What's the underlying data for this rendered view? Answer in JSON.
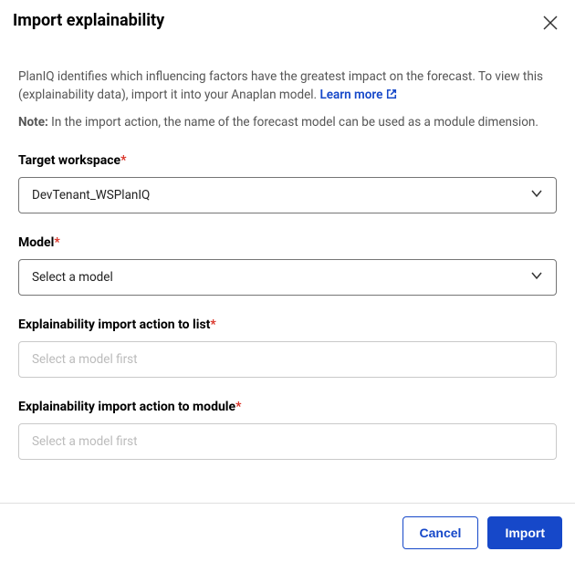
{
  "dialog": {
    "title": "Import explainability",
    "description_part1": "PlanIQ identifies which influencing factors have the greatest impact on the forecast. To view this (explainability data), import it into your Anaplan model. ",
    "learn_more": "Learn more",
    "note_label": "Note:",
    "note_text": " In the import action, the name of the forecast model can be used as a module dimension.",
    "fields": {
      "target_workspace": {
        "label": "Target workspace",
        "value": "DevTenant_WSPlanIQ"
      },
      "model": {
        "label": "Model",
        "placeholder": "Select a model"
      },
      "import_to_list": {
        "label": "Explainability import action to list",
        "placeholder": "Select a model first"
      },
      "import_to_module": {
        "label": "Explainability import action to module",
        "placeholder": "Select a model first"
      }
    },
    "buttons": {
      "cancel": "Cancel",
      "import": "Import"
    }
  }
}
